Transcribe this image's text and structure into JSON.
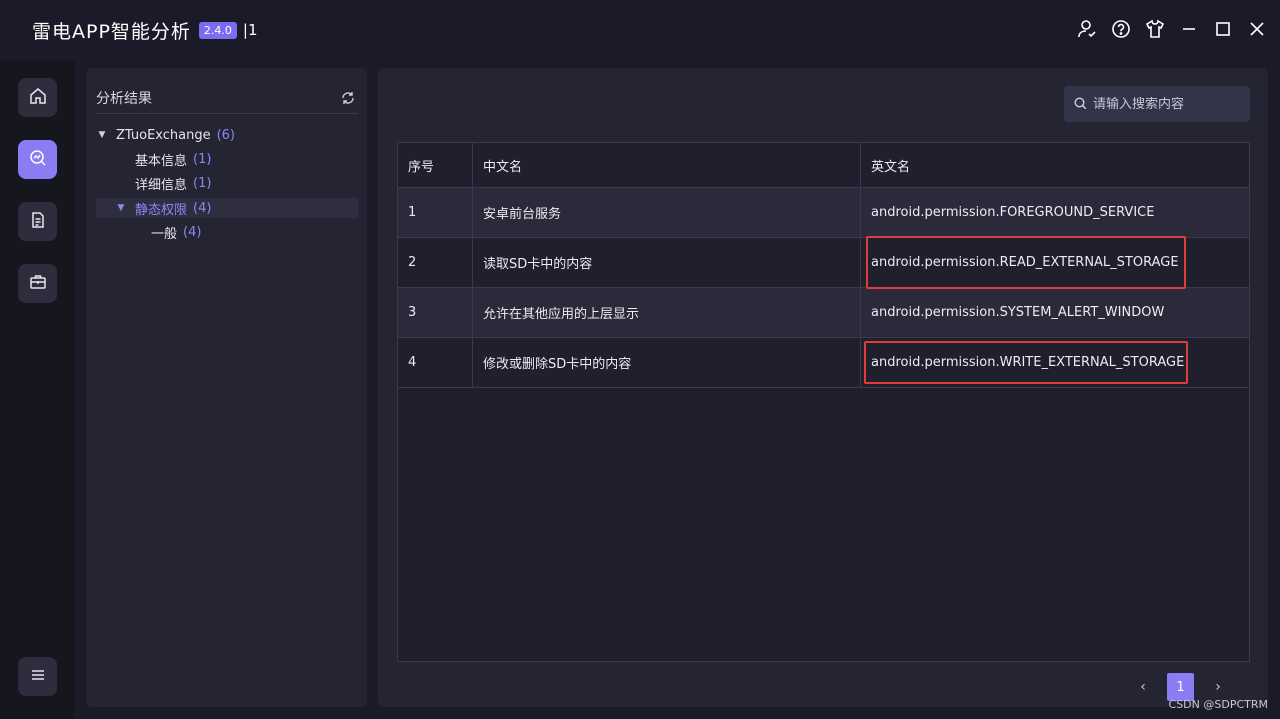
{
  "titlebar": {
    "app_name": "雷电APP智能分析",
    "version": "2.4.0",
    "extra": "|1"
  },
  "window_controls": [
    "user-check-icon",
    "help-icon",
    "theme-shirt-icon",
    "minimize-icon",
    "maximize-icon",
    "close-icon"
  ],
  "nav": {
    "items": [
      {
        "icon": "home-icon",
        "active": false
      },
      {
        "icon": "analysis-icon",
        "active": true
      },
      {
        "icon": "document-icon",
        "active": false
      },
      {
        "icon": "toolbox-icon",
        "active": false
      }
    ],
    "bottom_icon": "menu-icon"
  },
  "tree": {
    "title": "分析结果",
    "root": {
      "label": "ZTuoExchange",
      "count": "(6)"
    },
    "items": [
      {
        "label": "基本信息",
        "count": "(1)"
      },
      {
        "label": "详细信息",
        "count": "(1)"
      },
      {
        "label": "静态权限",
        "count": "(4)"
      },
      {
        "label": "一般",
        "count": "(4)"
      }
    ]
  },
  "search": {
    "placeholder": "请输入搜索内容"
  },
  "table": {
    "headers": [
      "序号",
      "中文名",
      "英文名"
    ],
    "rows": [
      {
        "index": "1",
        "cn": "安卓前台服务",
        "en": "android.permission.FOREGROUND_SERVICE"
      },
      {
        "index": "2",
        "cn": "读取SD卡中的内容",
        "en": "android.permission.READ_EXTERNAL_STORAGE"
      },
      {
        "index": "3",
        "cn": "允许在其他应用的上层显示",
        "en": "android.permission.SYSTEM_ALERT_WINDOW"
      },
      {
        "index": "4",
        "cn": "修改或删除SD卡中的内容",
        "en": "android.permission.WRITE_EXTERNAL_STORAGE"
      }
    ]
  },
  "pager": {
    "prev": "‹",
    "current": "1",
    "next": "›"
  },
  "watermark": "CSDN @SDPCTRM",
  "colors": {
    "accent": "#8a7cf2",
    "highlight": "#e23b3b"
  }
}
